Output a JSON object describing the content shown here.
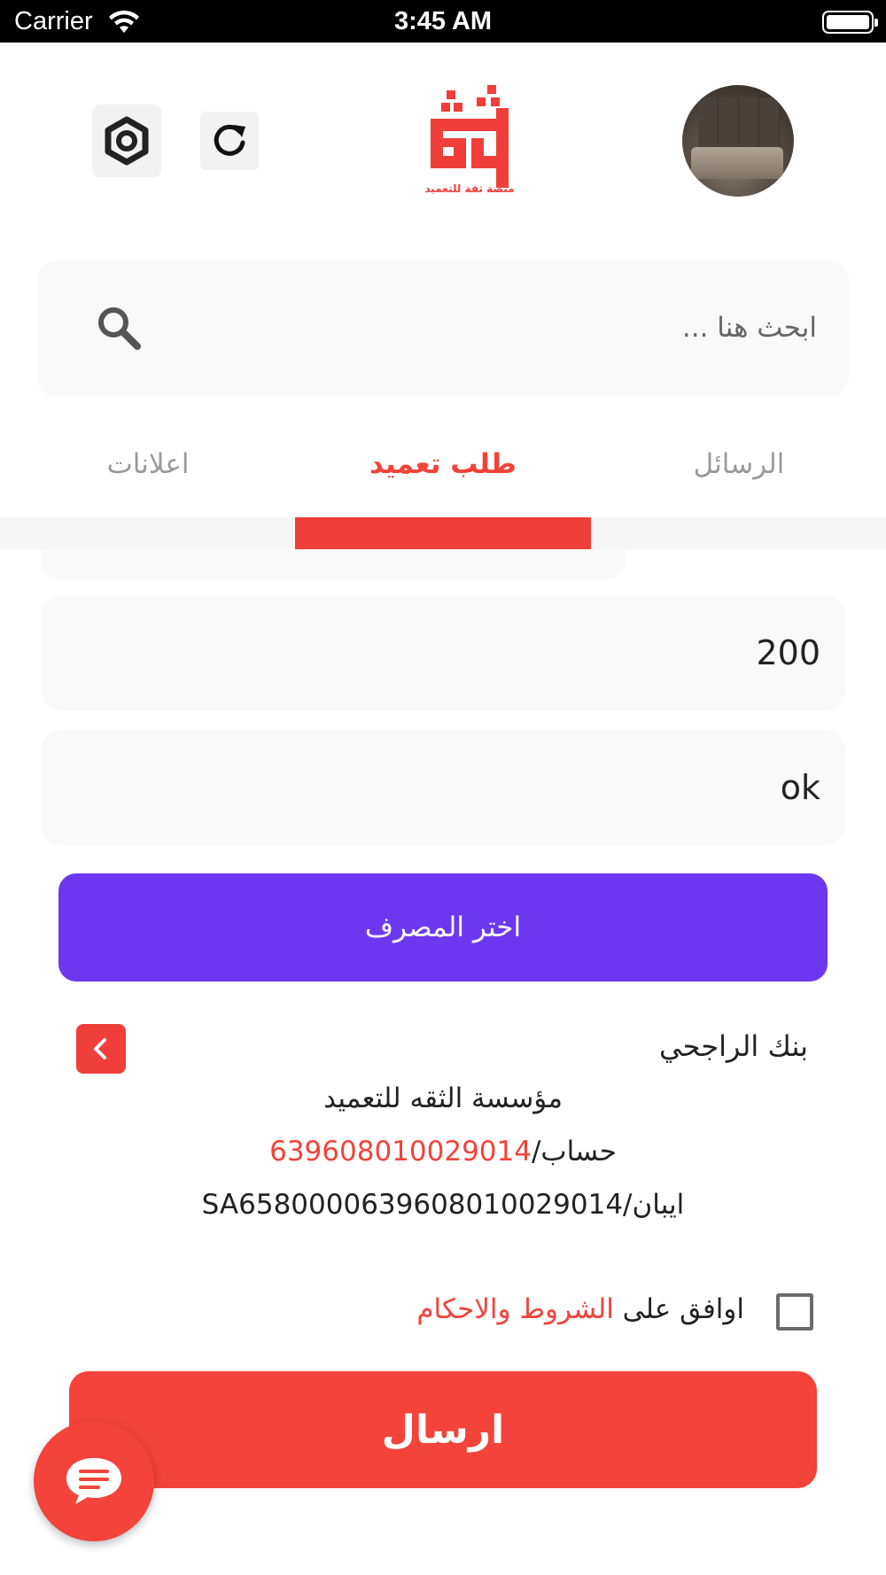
{
  "status_bar": {
    "carrier": "Carrier",
    "time": "3:45 AM"
  },
  "header": {
    "logo_text_main": "ثقة",
    "logo_text_sub": "منصة ثقة للتعميد"
  },
  "search": {
    "placeholder": "ابحث هنا ..."
  },
  "tabs": {
    "messages": "الرسائل",
    "request": "طلب تعميد",
    "ads": "اعلانات",
    "active": "request"
  },
  "form": {
    "amount_value": "200",
    "note_value": "ok",
    "choose_bank_label": "اختر المصرف"
  },
  "bank": {
    "name": "بنك الراجحي",
    "organization": "مؤسسة الثقه للتعميد",
    "account_label": "حساب/",
    "account_number": "639608010029014",
    "iban_label": "ايبان/",
    "iban_number": "SA6580000639608010029014"
  },
  "terms": {
    "prefix": "اوافق على ",
    "link": "الشروط والاحكام",
    "checked": false
  },
  "actions": {
    "send_label": "ارسال"
  },
  "colors": {
    "brand_red": "#f2433a",
    "bank_button_purple": "#6c38ef"
  }
}
